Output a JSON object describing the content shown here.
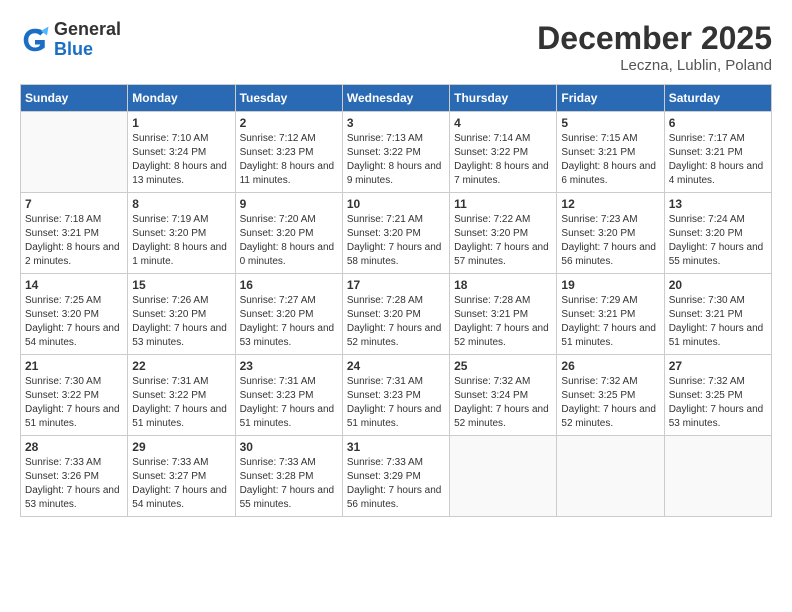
{
  "header": {
    "logo_general": "General",
    "logo_blue": "Blue",
    "month": "December 2025",
    "location": "Leczna, Lublin, Poland"
  },
  "days_of_week": [
    "Sunday",
    "Monday",
    "Tuesday",
    "Wednesday",
    "Thursday",
    "Friday",
    "Saturday"
  ],
  "weeks": [
    [
      {
        "day": "",
        "sunrise": "",
        "sunset": "",
        "daylight": ""
      },
      {
        "day": "1",
        "sunrise": "Sunrise: 7:10 AM",
        "sunset": "Sunset: 3:24 PM",
        "daylight": "Daylight: 8 hours and 13 minutes."
      },
      {
        "day": "2",
        "sunrise": "Sunrise: 7:12 AM",
        "sunset": "Sunset: 3:23 PM",
        "daylight": "Daylight: 8 hours and 11 minutes."
      },
      {
        "day": "3",
        "sunrise": "Sunrise: 7:13 AM",
        "sunset": "Sunset: 3:22 PM",
        "daylight": "Daylight: 8 hours and 9 minutes."
      },
      {
        "day": "4",
        "sunrise": "Sunrise: 7:14 AM",
        "sunset": "Sunset: 3:22 PM",
        "daylight": "Daylight: 8 hours and 7 minutes."
      },
      {
        "day": "5",
        "sunrise": "Sunrise: 7:15 AM",
        "sunset": "Sunset: 3:21 PM",
        "daylight": "Daylight: 8 hours and 6 minutes."
      },
      {
        "day": "6",
        "sunrise": "Sunrise: 7:17 AM",
        "sunset": "Sunset: 3:21 PM",
        "daylight": "Daylight: 8 hours and 4 minutes."
      }
    ],
    [
      {
        "day": "7",
        "sunrise": "Sunrise: 7:18 AM",
        "sunset": "Sunset: 3:21 PM",
        "daylight": "Daylight: 8 hours and 2 minutes."
      },
      {
        "day": "8",
        "sunrise": "Sunrise: 7:19 AM",
        "sunset": "Sunset: 3:20 PM",
        "daylight": "Daylight: 8 hours and 1 minute."
      },
      {
        "day": "9",
        "sunrise": "Sunrise: 7:20 AM",
        "sunset": "Sunset: 3:20 PM",
        "daylight": "Daylight: 8 hours and 0 minutes."
      },
      {
        "day": "10",
        "sunrise": "Sunrise: 7:21 AM",
        "sunset": "Sunset: 3:20 PM",
        "daylight": "Daylight: 7 hours and 58 minutes."
      },
      {
        "day": "11",
        "sunrise": "Sunrise: 7:22 AM",
        "sunset": "Sunset: 3:20 PM",
        "daylight": "Daylight: 7 hours and 57 minutes."
      },
      {
        "day": "12",
        "sunrise": "Sunrise: 7:23 AM",
        "sunset": "Sunset: 3:20 PM",
        "daylight": "Daylight: 7 hours and 56 minutes."
      },
      {
        "day": "13",
        "sunrise": "Sunrise: 7:24 AM",
        "sunset": "Sunset: 3:20 PM",
        "daylight": "Daylight: 7 hours and 55 minutes."
      }
    ],
    [
      {
        "day": "14",
        "sunrise": "Sunrise: 7:25 AM",
        "sunset": "Sunset: 3:20 PM",
        "daylight": "Daylight: 7 hours and 54 minutes."
      },
      {
        "day": "15",
        "sunrise": "Sunrise: 7:26 AM",
        "sunset": "Sunset: 3:20 PM",
        "daylight": "Daylight: 7 hours and 53 minutes."
      },
      {
        "day": "16",
        "sunrise": "Sunrise: 7:27 AM",
        "sunset": "Sunset: 3:20 PM",
        "daylight": "Daylight: 7 hours and 53 minutes."
      },
      {
        "day": "17",
        "sunrise": "Sunrise: 7:28 AM",
        "sunset": "Sunset: 3:20 PM",
        "daylight": "Daylight: 7 hours and 52 minutes."
      },
      {
        "day": "18",
        "sunrise": "Sunrise: 7:28 AM",
        "sunset": "Sunset: 3:21 PM",
        "daylight": "Daylight: 7 hours and 52 minutes."
      },
      {
        "day": "19",
        "sunrise": "Sunrise: 7:29 AM",
        "sunset": "Sunset: 3:21 PM",
        "daylight": "Daylight: 7 hours and 51 minutes."
      },
      {
        "day": "20",
        "sunrise": "Sunrise: 7:30 AM",
        "sunset": "Sunset: 3:21 PM",
        "daylight": "Daylight: 7 hours and 51 minutes."
      }
    ],
    [
      {
        "day": "21",
        "sunrise": "Sunrise: 7:30 AM",
        "sunset": "Sunset: 3:22 PM",
        "daylight": "Daylight: 7 hours and 51 minutes."
      },
      {
        "day": "22",
        "sunrise": "Sunrise: 7:31 AM",
        "sunset": "Sunset: 3:22 PM",
        "daylight": "Daylight: 7 hours and 51 minutes."
      },
      {
        "day": "23",
        "sunrise": "Sunrise: 7:31 AM",
        "sunset": "Sunset: 3:23 PM",
        "daylight": "Daylight: 7 hours and 51 minutes."
      },
      {
        "day": "24",
        "sunrise": "Sunrise: 7:31 AM",
        "sunset": "Sunset: 3:23 PM",
        "daylight": "Daylight: 7 hours and 51 minutes."
      },
      {
        "day": "25",
        "sunrise": "Sunrise: 7:32 AM",
        "sunset": "Sunset: 3:24 PM",
        "daylight": "Daylight: 7 hours and 52 minutes."
      },
      {
        "day": "26",
        "sunrise": "Sunrise: 7:32 AM",
        "sunset": "Sunset: 3:25 PM",
        "daylight": "Daylight: 7 hours and 52 minutes."
      },
      {
        "day": "27",
        "sunrise": "Sunrise: 7:32 AM",
        "sunset": "Sunset: 3:25 PM",
        "daylight": "Daylight: 7 hours and 53 minutes."
      }
    ],
    [
      {
        "day": "28",
        "sunrise": "Sunrise: 7:33 AM",
        "sunset": "Sunset: 3:26 PM",
        "daylight": "Daylight: 7 hours and 53 minutes."
      },
      {
        "day": "29",
        "sunrise": "Sunrise: 7:33 AM",
        "sunset": "Sunset: 3:27 PM",
        "daylight": "Daylight: 7 hours and 54 minutes."
      },
      {
        "day": "30",
        "sunrise": "Sunrise: 7:33 AM",
        "sunset": "Sunset: 3:28 PM",
        "daylight": "Daylight: 7 hours and 55 minutes."
      },
      {
        "day": "31",
        "sunrise": "Sunrise: 7:33 AM",
        "sunset": "Sunset: 3:29 PM",
        "daylight": "Daylight: 7 hours and 56 minutes."
      },
      {
        "day": "",
        "sunrise": "",
        "sunset": "",
        "daylight": ""
      },
      {
        "day": "",
        "sunrise": "",
        "sunset": "",
        "daylight": ""
      },
      {
        "day": "",
        "sunrise": "",
        "sunset": "",
        "daylight": ""
      }
    ]
  ]
}
